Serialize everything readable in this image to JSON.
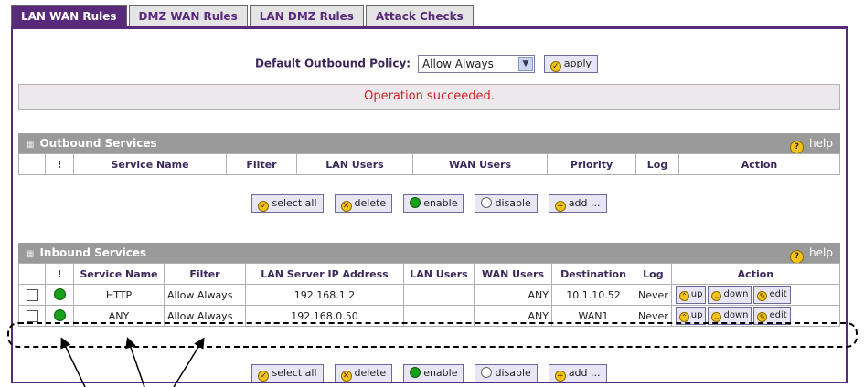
{
  "tabs": [
    {
      "label": "LAN WAN Rules",
      "active": true
    },
    {
      "label": "DMZ WAN Rules",
      "active": false
    },
    {
      "label": "LAN DMZ Rules",
      "active": false
    },
    {
      "label": "Attack Checks",
      "active": false
    }
  ],
  "policy": {
    "label": "Default Outbound Policy:",
    "selected": "Allow Always",
    "apply_label": "apply"
  },
  "status_message": "Operation succeeded.",
  "outbound": {
    "title": "Outbound Services",
    "help_label": "help",
    "columns": [
      "!",
      "Service Name",
      "Filter",
      "LAN Users",
      "WAN Users",
      "Priority",
      "Log",
      "Action"
    ],
    "buttons": {
      "select_all": "select all",
      "delete": "delete",
      "enable": "enable",
      "disable": "disable",
      "add": "add ..."
    }
  },
  "inbound": {
    "title": "Inbound Services",
    "help_label": "help",
    "columns": [
      "!",
      "Service Name",
      "Filter",
      "LAN Server IP Address",
      "LAN Users",
      "WAN Users",
      "Destination",
      "Log",
      "Action"
    ],
    "rows": [
      {
        "service": "HTTP",
        "filter": "Allow Always",
        "lan_server_ip": "192.168.1.2",
        "lan_users": "",
        "wan_users": "ANY",
        "destination": "10.1.10.52",
        "log": "Never",
        "up": "up",
        "down": "down",
        "edit": "edit"
      },
      {
        "service": "ANY",
        "filter": "Allow Always",
        "lan_server_ip": "192.168.0.50",
        "lan_users": "",
        "wan_users": "ANY",
        "destination": "WAN1",
        "log": "Never",
        "up": "up",
        "down": "down",
        "edit": "edit"
      }
    ],
    "buttons": {
      "select_all": "select all",
      "delete": "delete",
      "enable": "enable",
      "disable": "disable",
      "add": "add ..."
    }
  },
  "colors": {
    "accent": "#5a2a7a",
    "status_text": "#cc2222",
    "enabled_dot": "#19a019"
  }
}
